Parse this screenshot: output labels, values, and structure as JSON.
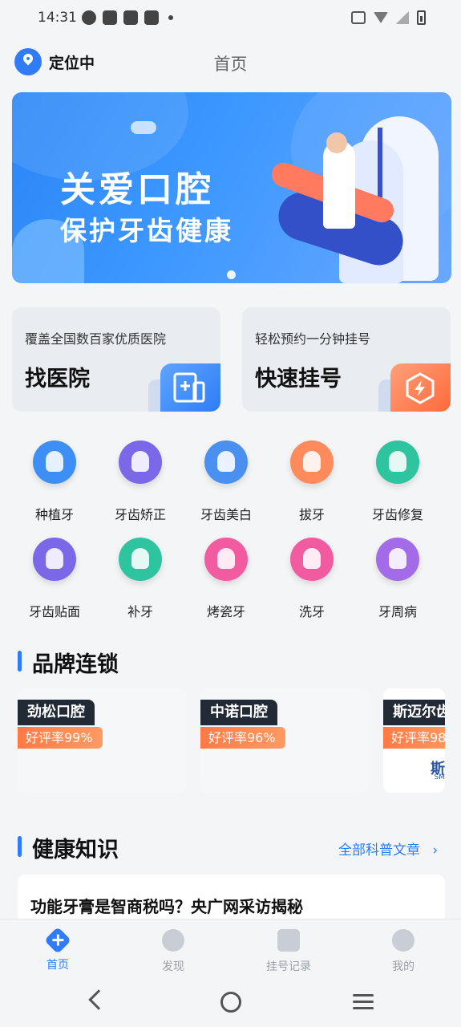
{
  "status_bar": {
    "time": "14:31"
  },
  "header": {
    "location_label": "定位中",
    "title": "首页"
  },
  "banner": {
    "line1": "关爱口腔",
    "line2": "保护牙齿健康"
  },
  "quick_cards": [
    {
      "subtitle": "覆盖全国数百家优质医院",
      "title": "找医院",
      "icon": "hospital-icon",
      "color": "#2f7cf6"
    },
    {
      "subtitle": "轻松预约一分钟挂号",
      "title": "快速挂号",
      "icon": "lightning-icon",
      "color": "#ff6a3a"
    }
  ],
  "services": [
    {
      "label": "种植牙",
      "icon": "implant-tooth-icon",
      "color": "#3d8ff5"
    },
    {
      "label": "牙齿矫正",
      "icon": "braces-tooth-icon",
      "color": "#7a68e8"
    },
    {
      "label": "牙齿美白",
      "icon": "whitening-tooth-icon",
      "color": "#4a90f0"
    },
    {
      "label": "拔牙",
      "icon": "extraction-tooth-icon",
      "color": "#ff8a5c"
    },
    {
      "label": "牙齿修复",
      "icon": "repair-tooth-icon",
      "color": "#2ec4a0"
    },
    {
      "label": "牙齿贴面",
      "icon": "veneer-tooth-icon",
      "color": "#7a68e8"
    },
    {
      "label": "补牙",
      "icon": "filling-tooth-icon",
      "color": "#2ec4a0"
    },
    {
      "label": "烤瓷牙",
      "icon": "porcelain-tooth-icon",
      "color": "#f25ba0"
    },
    {
      "label": "洗牙",
      "icon": "cleaning-tooth-icon",
      "color": "#f25ba0"
    },
    {
      "label": "牙周病",
      "icon": "periodontal-tooth-icon",
      "color": "#a36be8"
    }
  ],
  "brand_section": {
    "title": "品牌连锁",
    "brands": [
      {
        "name": "劲松口腔",
        "rating": "好评率99%"
      },
      {
        "name": "中诺口腔",
        "rating": "好评率96%"
      },
      {
        "name": "斯迈尔齿",
        "rating": "好评率98",
        "logo_text": "斯",
        "logo_sub": "SM"
      }
    ]
  },
  "health_section": {
    "title": "健康知识",
    "more_label": "全部科普文章",
    "articles": [
      {
        "title": "功能牙膏是智商税吗？央广网采访揭秘"
      }
    ]
  },
  "bottom_nav": [
    {
      "label": "首页",
      "icon": "home-icon",
      "active": true
    },
    {
      "label": "发现",
      "icon": "discover-icon",
      "active": false
    },
    {
      "label": "挂号记录",
      "icon": "clipboard-icon",
      "active": false
    },
    {
      "label": "我的",
      "icon": "profile-icon",
      "active": false
    }
  ],
  "colors": {
    "accent": "#2f7cf6",
    "rating_orange": "#ff7a45",
    "background": "#f4f5f7"
  }
}
